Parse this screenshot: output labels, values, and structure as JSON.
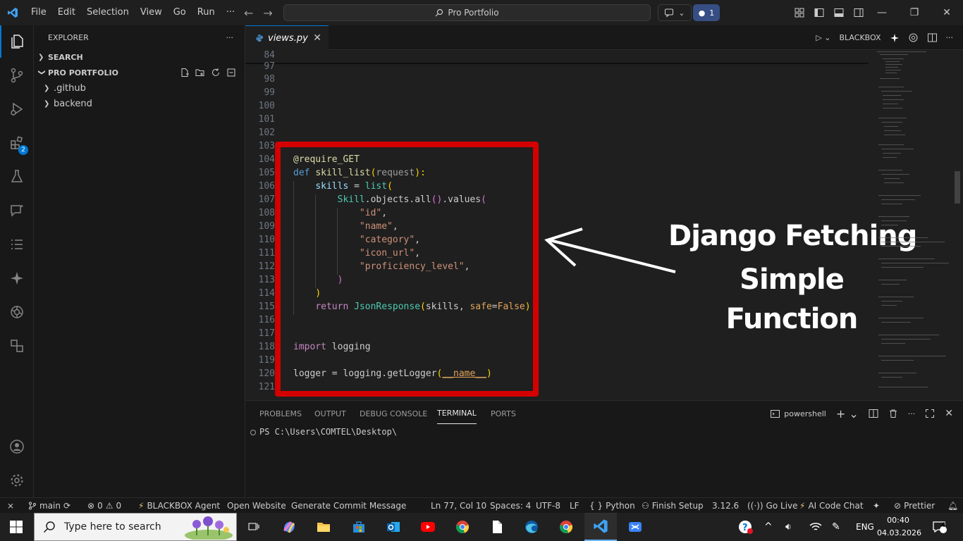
{
  "menu": [
    "File",
    "Edit",
    "Selection",
    "View",
    "Go",
    "Run",
    "···"
  ],
  "search": {
    "label": "Pro Portfolio"
  },
  "notifications": {
    "count": "1"
  },
  "explorer": {
    "title": "EXPLORER",
    "more": "···",
    "search_section": "SEARCH",
    "project_section": "PRO PORTFOLIO",
    "items": [
      ".github",
      "backend"
    ]
  },
  "activity": {
    "extensions_badge": "2"
  },
  "tab": {
    "filename": "views.py",
    "close": "✕"
  },
  "editor_actions": {
    "agent": "BLACKBOX"
  },
  "editor": {
    "lines": [
      {
        "n": "84"
      },
      {
        "n": "97"
      },
      {
        "n": "98"
      },
      {
        "n": "99"
      },
      {
        "n": "100"
      },
      {
        "n": "101"
      },
      {
        "n": "102"
      },
      {
        "n": "103"
      },
      {
        "n": "104"
      },
      {
        "n": "105"
      },
      {
        "n": "106"
      },
      {
        "n": "107"
      },
      {
        "n": "108"
      },
      {
        "n": "109"
      },
      {
        "n": "110"
      },
      {
        "n": "111"
      },
      {
        "n": "112"
      },
      {
        "n": "113"
      },
      {
        "n": "114"
      },
      {
        "n": "115"
      },
      {
        "n": "116"
      },
      {
        "n": "117"
      },
      {
        "n": "118"
      },
      {
        "n": "119"
      },
      {
        "n": "120"
      },
      {
        "n": "121"
      }
    ],
    "code": {
      "l104": "@require_GET",
      "l105_def": "def",
      "l105_fn": "skill_list",
      "l105_p1": "(",
      "l105_param": "request",
      "l105_p2": "):",
      "l106_var": "skills",
      "l106_eq": " = ",
      "l106_fn": "list",
      "l106_p": "(",
      "l107_cls": "Skill",
      "l107_rest": ".objects.all",
      "l107_p1": "()",
      "l107_vals": ".values",
      "l107_p2": "(",
      "l108": "\"id\"",
      "l109": "\"name\"",
      "l110": "\"category\"",
      "l111": "\"icon_url\"",
      "l112": "\"proficiency_level\"",
      "comma": ",",
      "l113": ")",
      "l114": ")",
      "l115_kw": "return",
      "l115_fn": "JsonResponse",
      "l115_p1": "(",
      "l115_arg": "skills, ",
      "l115_kwarg": "safe",
      "l115_eq": "=",
      "l115_val": "False",
      "l115_p2": ")",
      "l118_kw": "import",
      "l118_mod": " logging",
      "l120_var": "logger",
      "l120_eq": " = ",
      "l120_mod": "logging",
      "l120_fn": ".getLogger",
      "l120_p1": "(",
      "l120_arg": "__name__",
      "l120_p2": ")"
    }
  },
  "overlay": {
    "line1": "Django Fetching",
    "line2": "Simple",
    "line3": "Function"
  },
  "panel": {
    "tabs": [
      "PROBLEMS",
      "OUTPUT",
      "DEBUG CONSOLE",
      "TERMINAL",
      "PORTS"
    ],
    "active_tab": "TERMINAL",
    "shell": "powershell",
    "prompt": "PS C:\\Users\\COMTEL\\Desktop\\"
  },
  "status": {
    "branch": "main",
    "errors": "0",
    "warnings": "0",
    "blackbox": "BLACKBOX Agent",
    "open_website": "Open Website",
    "commit": "Generate Commit Message",
    "position": "Ln 77, Col 10",
    "spaces": "Spaces: 4",
    "encoding": "UTF-8",
    "eol": "LF",
    "language": "Python",
    "finish_setup": "Finish Setup",
    "version": "3.12.6",
    "go_live": "Go Live",
    "ai_chat": "AI Code Chat",
    "prettier": "Prettier"
  },
  "taskbar": {
    "search_placeholder": "Type here to search",
    "language": "ENG",
    "time": "00:40",
    "date": "04.03.2026",
    "notif_count": "4"
  },
  "colors": {
    "accent": "#0078d4",
    "highlight_border": "#d40000",
    "editor_bg": "#1f1f1f"
  }
}
